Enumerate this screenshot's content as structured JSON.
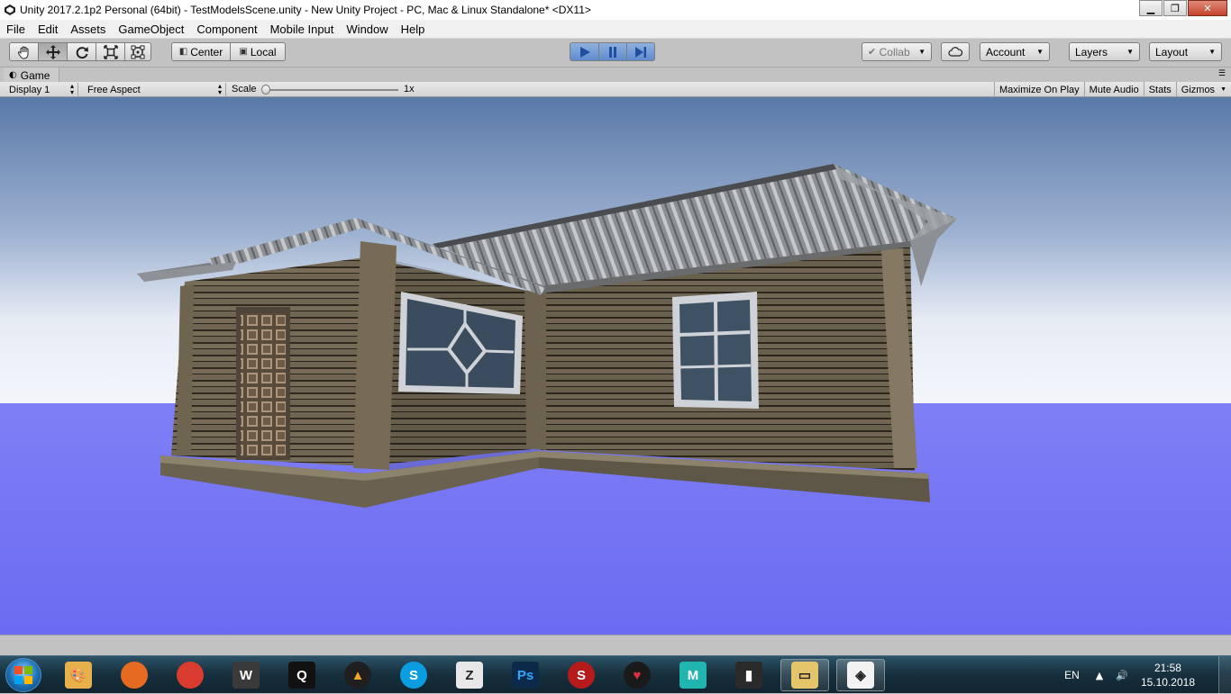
{
  "window": {
    "title": "Unity 2017.2.1p2 Personal (64bit) - TestModelsScene.unity - New Unity Project - PC, Mac & Linux Standalone* <DX11>",
    "minimize": "▁",
    "maximize": "❐",
    "close": "✕"
  },
  "menu": {
    "items": [
      "File",
      "Edit",
      "Assets",
      "GameObject",
      "Component",
      "Mobile Input",
      "Window",
      "Help"
    ]
  },
  "toolbar": {
    "transform_tools": [
      "hand-icon",
      "move-icon",
      "rotate-icon",
      "scale-icon",
      "rect-icon"
    ],
    "pivot_mode": "Center",
    "pivot_rotation": "Local",
    "playback": [
      "play-icon",
      "pause-icon",
      "step-icon"
    ],
    "collab_label": "Collab",
    "account_label": "Account",
    "layers_label": "Layers",
    "layout_label": "Layout",
    "colors": {
      "play_active": "#5f8ccf"
    }
  },
  "game_tab": {
    "label": "Game",
    "display": "Display 1",
    "aspect": "Free Aspect",
    "scale_label": "Scale",
    "scale_value": "1x",
    "scale_level": 0.0,
    "toggles": [
      "Maximize On Play",
      "Mute Audio",
      "Stats",
      "Gizmos"
    ]
  },
  "viewport": {
    "sky_top": "#5a79a8",
    "sky_horizon": "#f4f6fb",
    "ground": "#6f6ff4",
    "object": "wooden-house"
  },
  "taskbar": {
    "apps": [
      {
        "name": "paint-icon",
        "glyph": "🎨",
        "color": "#e8b04b"
      },
      {
        "name": "firefox-icon",
        "glyph": "",
        "color": "#e66a1f"
      },
      {
        "name": "chrome-icon",
        "glyph": "",
        "color": "#d93b2f"
      },
      {
        "name": "world-of-tanks-icon",
        "glyph": "W",
        "color": "#3a3a3a"
      },
      {
        "name": "quixel-icon",
        "glyph": "Q",
        "color": "#111111"
      },
      {
        "name": "artstation-icon",
        "glyph": "▲",
        "color": "#1f1f1f"
      },
      {
        "name": "skype-icon",
        "glyph": "S",
        "color": "#0a9ee0"
      },
      {
        "name": "zbrush-icon",
        "glyph": "Z",
        "color": "#e8e8e8"
      },
      {
        "name": "photoshop-icon",
        "glyph": "Ps",
        "color": "#0b2a4a"
      },
      {
        "name": "substance-icon",
        "glyph": "S",
        "color": "#b61b1b"
      },
      {
        "name": "marmoset-icon",
        "glyph": "♥",
        "color": "#1a1a1a"
      },
      {
        "name": "maya-icon",
        "glyph": "M",
        "color": "#21b5b0"
      },
      {
        "name": "audio-meter-icon",
        "glyph": "▮",
        "color": "#2a2a2a"
      },
      {
        "name": "file-explorer-icon",
        "glyph": "▭",
        "color": "#e5c56a"
      },
      {
        "name": "unity-icon",
        "glyph": "◈",
        "color": "#f2f2f2"
      }
    ],
    "language": "EN",
    "time": "21:58",
    "date": "15.10.2018"
  }
}
